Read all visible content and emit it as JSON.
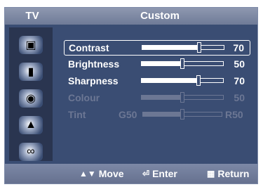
{
  "header": {
    "source_label": "TV",
    "menu_title": "Custom"
  },
  "sidebar": {
    "icons": [
      "picture-icon",
      "sound-icon",
      "channel-icon",
      "setup-icon",
      "input-icon"
    ]
  },
  "settings": [
    {
      "label": "Contrast",
      "value": "70",
      "level": 70,
      "enabled": true,
      "selected": true
    },
    {
      "label": "Brightness",
      "value": "50",
      "level": 50,
      "enabled": true,
      "selected": false
    },
    {
      "label": "Sharpness",
      "value": "70",
      "level": 70,
      "enabled": true,
      "selected": false
    },
    {
      "label": "Colour",
      "value": "50",
      "level": 50,
      "enabled": false,
      "selected": false
    },
    {
      "label": "Tint",
      "left_value": "G50",
      "right_value": "R50",
      "level": 50,
      "enabled": false,
      "selected": false
    }
  ],
  "footer": {
    "move_label": "Move",
    "move_icon": "up-down-arrow-icon",
    "enter_label": "Enter",
    "enter_icon": "enter-key-icon",
    "return_label": "Return",
    "return_icon": "return-icon"
  },
  "colors": {
    "panel": "#3a4d73",
    "bar": "#7c88a6",
    "text": "#ffffff",
    "disabled": "#6c7794"
  }
}
